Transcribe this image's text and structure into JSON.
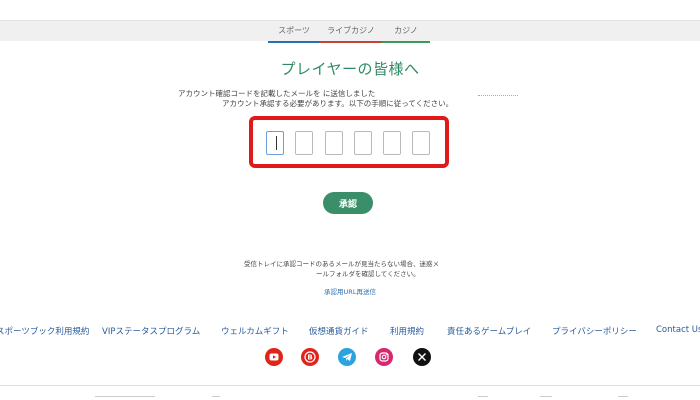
{
  "nav": {
    "tabs": [
      {
        "label": "スポーツ"
      },
      {
        "label": "ライブカジノ"
      },
      {
        "label": "カジノ"
      }
    ]
  },
  "main": {
    "title": "プレイヤーの皆様へ",
    "message_line1": "アカウント確認コードを記載したメールを に送信しました",
    "message_line2": "アカウント承認する必要があります。以下の手順に従ってください。",
    "code_inputs": [
      "",
      "",
      "",
      "",
      "",
      ""
    ],
    "approve_label": "承認",
    "note_line1": "受信トレイに承認コードのあるメールが見当たらない場合、迷惑メ",
    "note_line2": "ールフォルダを確認してください。",
    "resend_label": "承認用URL再送信"
  },
  "footer": {
    "links": [
      {
        "label": "スポーツブック利用規約"
      },
      {
        "label": "VIPステータスプログラム"
      },
      {
        "label": "ウェルカムギフト"
      },
      {
        "label": "仮想通貨ガイド"
      },
      {
        "label": "利用規約"
      },
      {
        "label": "責任あるゲームプレイ"
      },
      {
        "label": "プライバシーポリシー"
      },
      {
        "label": "Contact Us"
      }
    ],
    "social": [
      {
        "icon": "youtube-icon",
        "color": "#e2231a"
      },
      {
        "icon": "b-logo-icon",
        "color": "#e2231a"
      },
      {
        "icon": "telegram-icon",
        "color": "#2aa3df"
      },
      {
        "icon": "instagram-icon",
        "color": "#d6286f"
      },
      {
        "icon": "x-icon",
        "color": "#111111"
      }
    ]
  },
  "colors": {
    "accent": "#2f8a63",
    "highlight_border": "#e0191b",
    "link": "#2a5a9a"
  }
}
